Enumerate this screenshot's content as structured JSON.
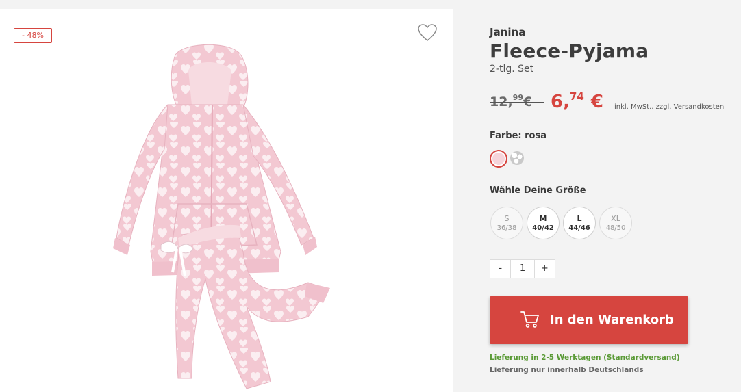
{
  "badge": {
    "discount": "- 48%"
  },
  "product": {
    "brand": "Janina",
    "title": "Fleece-Pyjama",
    "subtitle": "2-tlg. Set"
  },
  "price": {
    "old_main": "12,",
    "old_cents": "99",
    "old_currency": "€",
    "new_main": "6,",
    "new_cents": "74",
    "new_currency": "€",
    "tax_note": "inkl. MwSt., zzgl. Versandkosten"
  },
  "color": {
    "label": "Farbe: rosa",
    "options": [
      "rosa",
      "grau gemustert"
    ]
  },
  "sizes": {
    "label": "Wähle Deine Größe",
    "options": [
      {
        "name": "S",
        "range": "36/38",
        "available": false
      },
      {
        "name": "M",
        "range": "40/42",
        "available": true
      },
      {
        "name": "L",
        "range": "44/46",
        "available": true
      },
      {
        "name": "XL",
        "range": "48/50",
        "available": false
      }
    ]
  },
  "quantity": {
    "minus": "-",
    "value": "1",
    "plus": "+"
  },
  "cart": {
    "label": "In den Warenkorb"
  },
  "delivery": {
    "time": "Lieferung in 2-5 Werktagen (Standardversand)",
    "region": "Lieferung nur innerhalb Deutschlands"
  },
  "colors": {
    "accent": "#d6453f",
    "delivery_green": "#5a9a36",
    "pink": "#f6d4da"
  }
}
